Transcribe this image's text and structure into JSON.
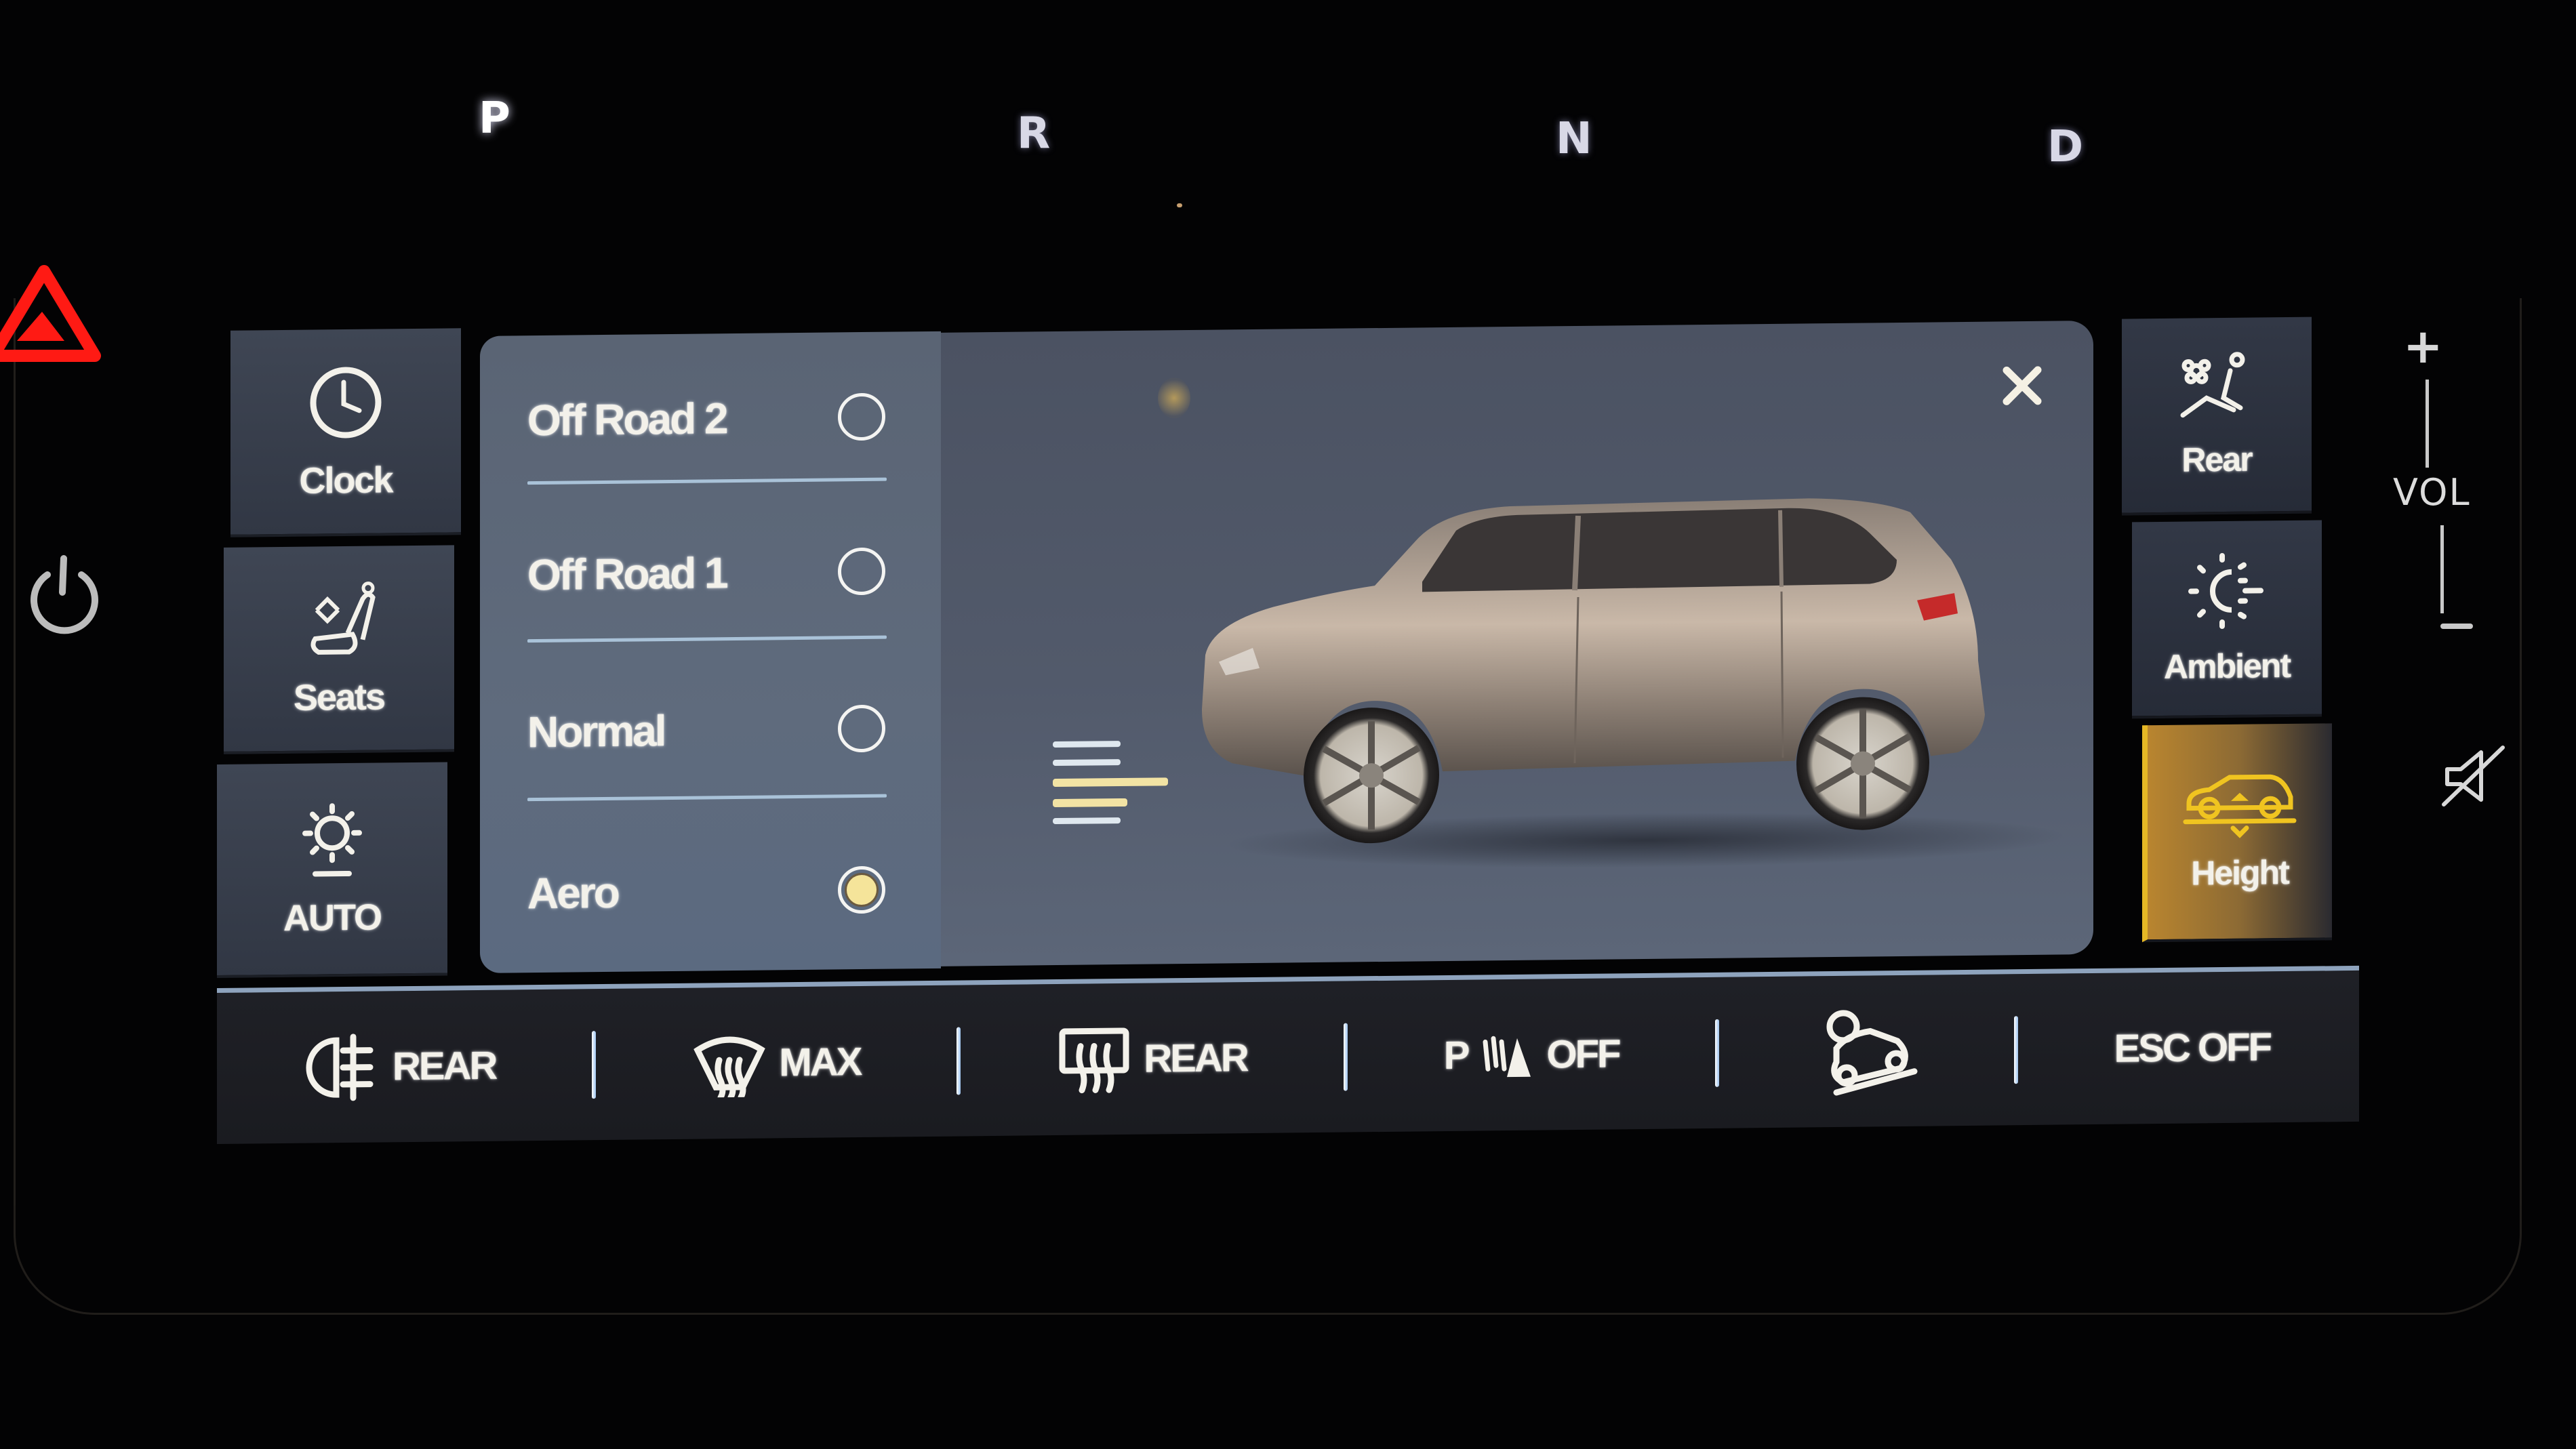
{
  "gear_selector": {
    "gears": [
      "P",
      "R",
      "N",
      "D"
    ],
    "active": "P"
  },
  "hardware": {
    "hazard_icon": "hazard-triangle-icon",
    "power_icon": "power-icon",
    "volume_label": "VOL",
    "volume_up": "+",
    "volume_down": "−",
    "mute_icon": "mute-icon"
  },
  "left_sidebar": {
    "items": [
      {
        "label": "Clock",
        "icon": "clock-icon"
      },
      {
        "label": "Seats",
        "icon": "seat-adjust-icon"
      },
      {
        "label": "AUTO",
        "icon": "auto-brightness-icon"
      }
    ]
  },
  "drive_modes": {
    "options": [
      {
        "label": "Off Road 2",
        "selected": false
      },
      {
        "label": "Off Road 1",
        "selected": false
      },
      {
        "label": "Normal",
        "selected": false
      },
      {
        "label": "Aero",
        "selected": true
      }
    ],
    "selected": "Aero"
  },
  "car_view": {
    "close_icon": "close-icon",
    "height_indicator": {
      "levels": 5,
      "active_level": "Aero"
    }
  },
  "right_sidebar": {
    "items": [
      {
        "label": "Rear",
        "icon": "rear-climate-icon",
        "active": false
      },
      {
        "label": "Ambient",
        "icon": "ambient-light-icon",
        "active": false
      },
      {
        "label": "Height",
        "icon": "ride-height-icon",
        "active": true
      }
    ]
  },
  "bottom_bar": {
    "items": [
      {
        "label": "REAR",
        "icon": "rear-fog-light-icon"
      },
      {
        "label": "MAX",
        "icon": "max-defrost-icon"
      },
      {
        "label": "REAR",
        "icon": "rear-defrost-icon"
      },
      {
        "label": "OFF",
        "icon": "park-sensor-icon",
        "prefix": "P"
      },
      {
        "label": "",
        "icon": "hill-descent-icon"
      },
      {
        "label": "ESC OFF",
        "icon": ""
      }
    ]
  },
  "colors": {
    "accent_yellow": "#e5b725",
    "selected_radio": "#f5e49a",
    "hazard_red": "#ff1a14",
    "divider_blue": "#a9c2d8"
  }
}
